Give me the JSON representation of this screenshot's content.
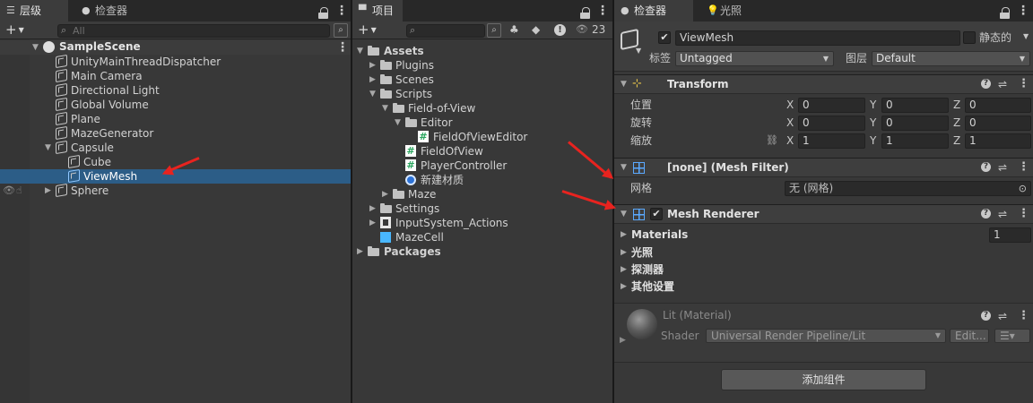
{
  "hierarchy": {
    "tabs": [
      {
        "label": "层级",
        "icon": "list-icon"
      },
      {
        "label": "检查器",
        "icon": "info-icon"
      }
    ],
    "search_placeholder": "All",
    "scene": "SampleScene",
    "items": [
      {
        "label": "UnityMainThreadDispatcher"
      },
      {
        "label": "Main Camera"
      },
      {
        "label": "Directional Light"
      },
      {
        "label": "Global Volume"
      },
      {
        "label": "Plane"
      },
      {
        "label": "MazeGenerator"
      },
      {
        "label": "Capsule"
      },
      {
        "label": "Cube"
      },
      {
        "label": "ViewMesh"
      },
      {
        "label": "Sphere"
      }
    ]
  },
  "project": {
    "tab": "项目",
    "hidden_count": "23",
    "tree": [
      {
        "label": "Assets"
      },
      {
        "label": "Plugins"
      },
      {
        "label": "Scenes"
      },
      {
        "label": "Scripts"
      },
      {
        "label": "Field-of-View"
      },
      {
        "label": "Editor"
      },
      {
        "label": "FieldOfViewEditor"
      },
      {
        "label": "FieldOfView"
      },
      {
        "label": "PlayerController"
      },
      {
        "label": "新建材质"
      },
      {
        "label": "Maze"
      },
      {
        "label": "Settings"
      },
      {
        "label": "InputSystem_Actions"
      },
      {
        "label": "MazeCell"
      },
      {
        "label": "Packages"
      }
    ]
  },
  "inspector": {
    "tabs": [
      {
        "label": "检查器",
        "icon": "info-icon"
      },
      {
        "label": "光照",
        "icon": "lightbulb-icon"
      }
    ],
    "object_name": "ViewMesh",
    "static_label": "静态的",
    "tag_label": "标签",
    "tag_value": "Untagged",
    "layer_label": "图层",
    "layer_value": "Default",
    "transform": {
      "title": "Transform",
      "position_label": "位置",
      "rotation_label": "旋转",
      "scale_label": "缩放",
      "axis_x": "X",
      "axis_y": "Y",
      "axis_z": "Z",
      "position": [
        "0",
        "0",
        "0"
      ],
      "rotation": [
        "0",
        "0",
        "0"
      ],
      "scale": [
        "1",
        "1",
        "1"
      ]
    },
    "mesh_filter": {
      "title": "[none] (Mesh Filter)",
      "mesh_label": "网格",
      "mesh_value": "无 (网格)"
    },
    "mesh_renderer": {
      "title": "Mesh Renderer",
      "materials_label": "Materials",
      "materials_count": "1",
      "sections": [
        "光照",
        "探测器",
        "其他设置"
      ]
    },
    "material": {
      "title": "Lit (Material)",
      "shader_label": "Shader",
      "shader_value": "Universal Render Pipeline/Lit",
      "edit_label": "Edit..."
    },
    "add_component_label": "添加组件"
  },
  "colors": {
    "selection": "#2c5d87",
    "panel_bg": "#383838",
    "annotation_arrow": "#e8231f"
  }
}
